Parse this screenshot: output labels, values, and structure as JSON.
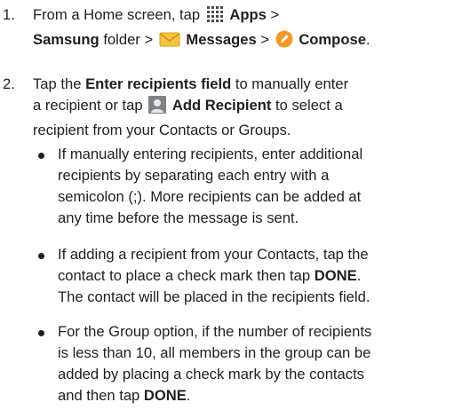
{
  "steps": [
    {
      "number": "1.",
      "line1_pre": "From a Home screen, tap",
      "apps_label": "Apps",
      "gt1": ">",
      "samsung_label": "Samsung",
      "line2_folder": "folder >",
      "messages_label": "Messages",
      "gt2": ">",
      "compose_label": "Compose",
      "period": "."
    },
    {
      "number": "2.",
      "tap": "Tap the",
      "enter_field_label": "Enter recipients field",
      "line1_post": "to manually enter",
      "line2_pre": "a recipient or tap",
      "add_recipient_label": "Add Recipient",
      "line2_post": "to select a",
      "line3": "recipient from your Contacts or Groups."
    }
  ],
  "bullets": [
    {
      "lines": [
        "If manually entering recipients, enter additional",
        "recipients by separating each entry with a",
        "semicolon (;). More recipients can be added at",
        "any time before the message is sent."
      ]
    },
    {
      "line1": "If adding a recipient from your Contacts, tap the",
      "line2_pre": "contact to place a check mark then tap",
      "line2_bold": "DONE",
      "line2_post": ".",
      "line3": "The contact will be placed in the recipients field."
    },
    {
      "line1": "For the Group option, if the number of recipients",
      "line2": "is less than 10, all members in the group can be",
      "line3": "added by placing a check mark by the contacts",
      "line4_pre": "and then tap",
      "line4_bold": "DONE",
      "line4_post": "."
    }
  ],
  "icons": {
    "apps": "apps-grid-icon",
    "messages": "messages-envelope-icon",
    "compose": "compose-pencil-icon",
    "add_recipient": "add-recipient-person-icon"
  },
  "colors": {
    "messages_envelope": "#f4c542",
    "compose_circle": "#f39a2b",
    "person_icon_bg": "#7d8287",
    "text": "#1f1f1f"
  }
}
